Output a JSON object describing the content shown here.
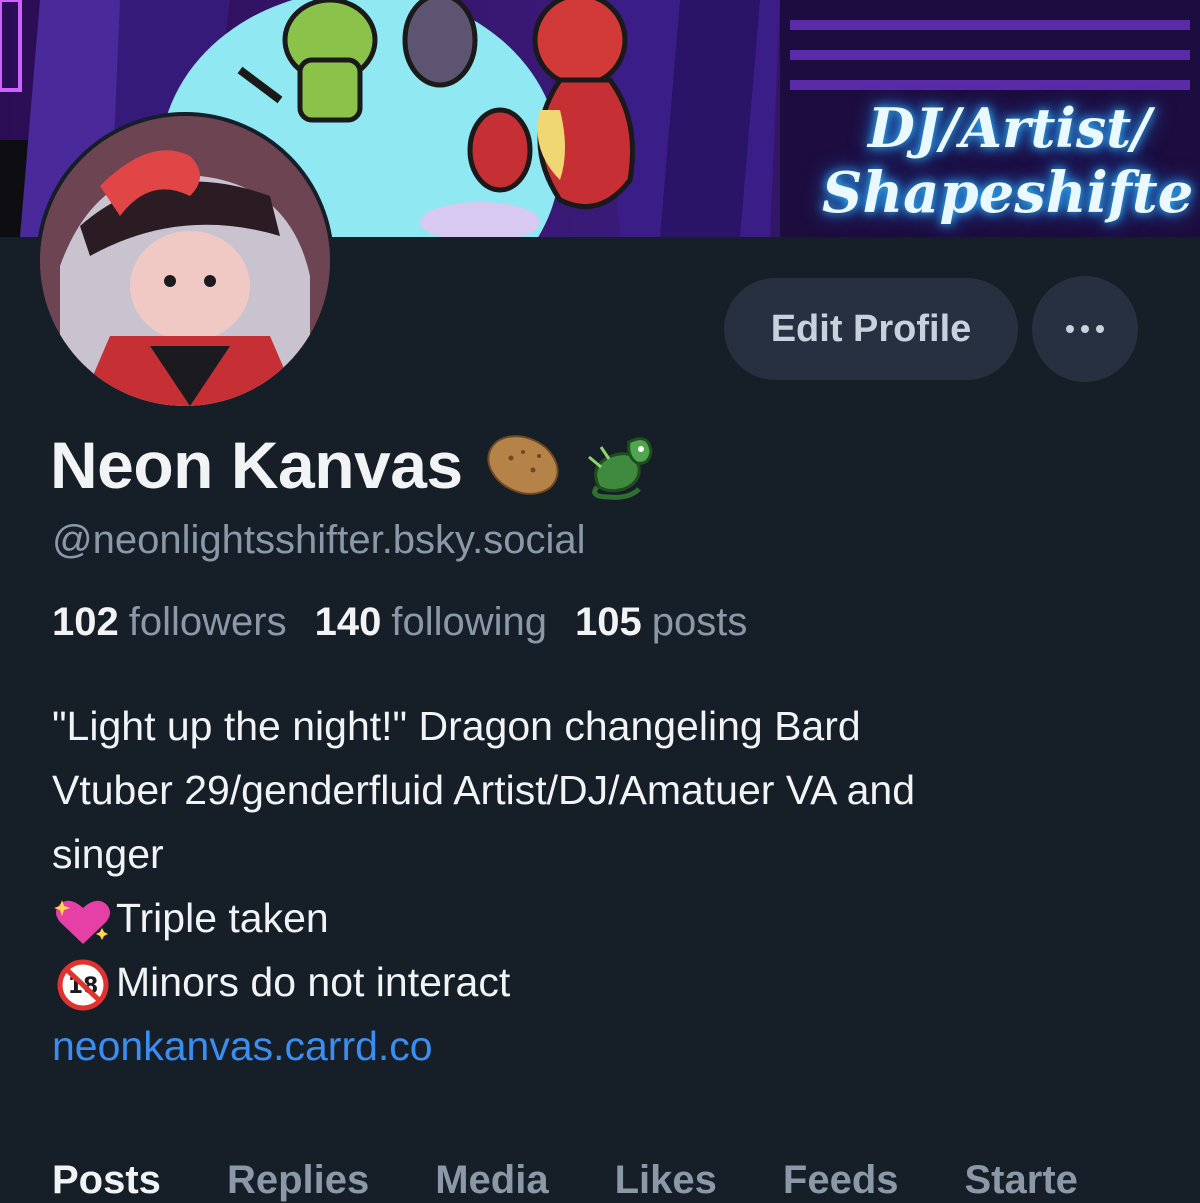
{
  "banner": {
    "line1": "DJ/Artist/",
    "line2": "Shapeshifte"
  },
  "profile": {
    "display_name": "Neon Kanvas",
    "handle": "@neonlightsshifter.bsky.social",
    "name_emojis": [
      "potato-icon",
      "dragon-icon"
    ]
  },
  "actions": {
    "edit_label": "Edit Profile",
    "more_icon": "ellipsis-icon"
  },
  "stats": {
    "followers_count": "102",
    "followers_label": "followers",
    "following_count": "140",
    "following_label": "following",
    "posts_count": "105",
    "posts_label": "posts"
  },
  "bio": {
    "line1": "\"Light up the night!\" Dragon changeling Bard",
    "line2": "Vtuber 29/genderfluid Artist/DJ/Amatuer VA and",
    "line3": "singer",
    "line4": "Triple taken",
    "line5": "Minors do not interact",
    "link": "neonkanvas.carrd.co"
  },
  "tabs": [
    "Posts",
    "Replies",
    "Media",
    "Likes",
    "Feeds",
    "Starte"
  ],
  "colors": {
    "background": "#161e27",
    "accent_link": "#3b8ef0",
    "button_bg": "#263040",
    "muted_text": "#8b98a7"
  }
}
